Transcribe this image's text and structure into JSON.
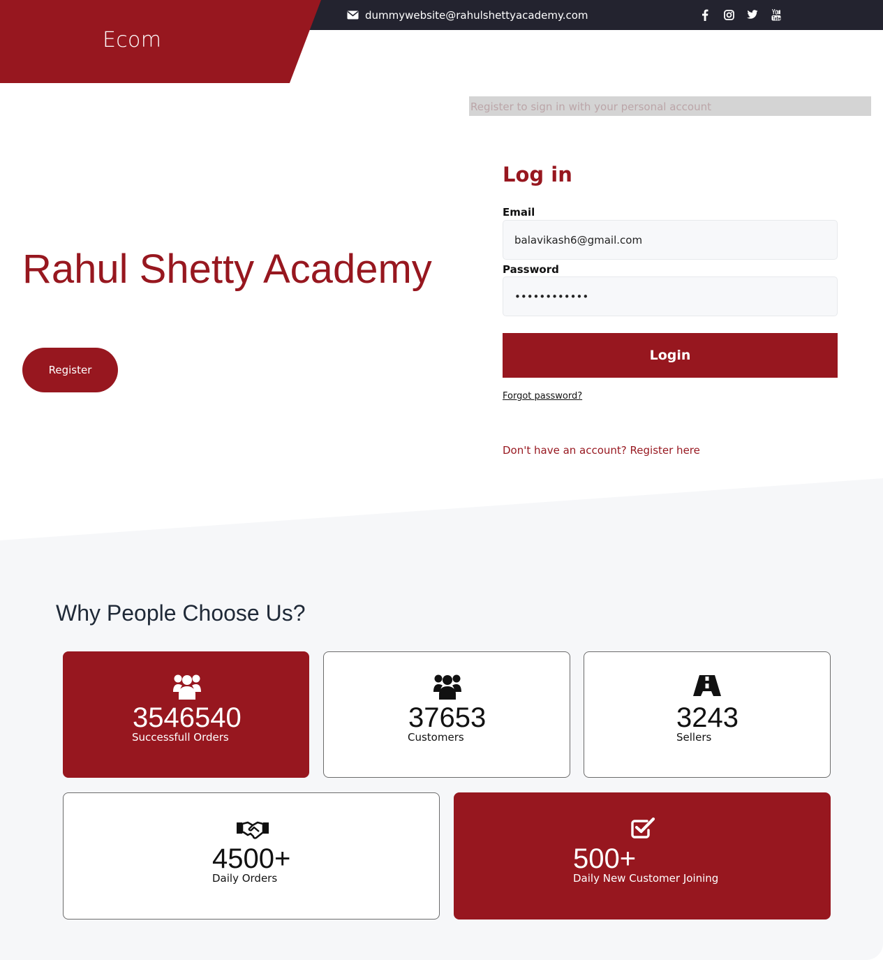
{
  "header": {
    "brand": "Ecom",
    "email": "dummywebsite@rahulshettyacademy.com",
    "socials": [
      "facebook-icon",
      "instagram-icon",
      "twitter-icon",
      "youtube-icon"
    ]
  },
  "banner": {
    "text": "Register to sign in with your personal account"
  },
  "hero": {
    "title": "Rahul Shetty Academy",
    "register_label": "Register"
  },
  "login": {
    "heading": "Log in",
    "email_label": "Email",
    "email_value": "balavikash6@gmail.com",
    "password_label": "Password",
    "password_value": "••••••••••••",
    "login_label": "Login",
    "forgot_label": "Forgot password?",
    "register_label": "Don't have an account? Register here"
  },
  "stats": {
    "title": "Why People Choose Us?",
    "items": [
      {
        "value": "3546540",
        "label": "Successfull Orders",
        "icon": "users-icon",
        "highlight": true
      },
      {
        "value": "37653",
        "label": "Customers",
        "icon": "users-icon",
        "highlight": false
      },
      {
        "value": "3243",
        "label": "Sellers",
        "icon": "road-icon",
        "highlight": false
      },
      {
        "value": "4500+",
        "label": "Daily Orders",
        "icon": "handshake-icon",
        "highlight": false
      },
      {
        "value": "500+",
        "label": "Daily New Customer Joining",
        "icon": "check-square-icon",
        "highlight": true
      }
    ]
  },
  "colors": {
    "brand": "#97171f",
    "topbar": "#23232f",
    "section_bg": "#f6f7f9"
  }
}
